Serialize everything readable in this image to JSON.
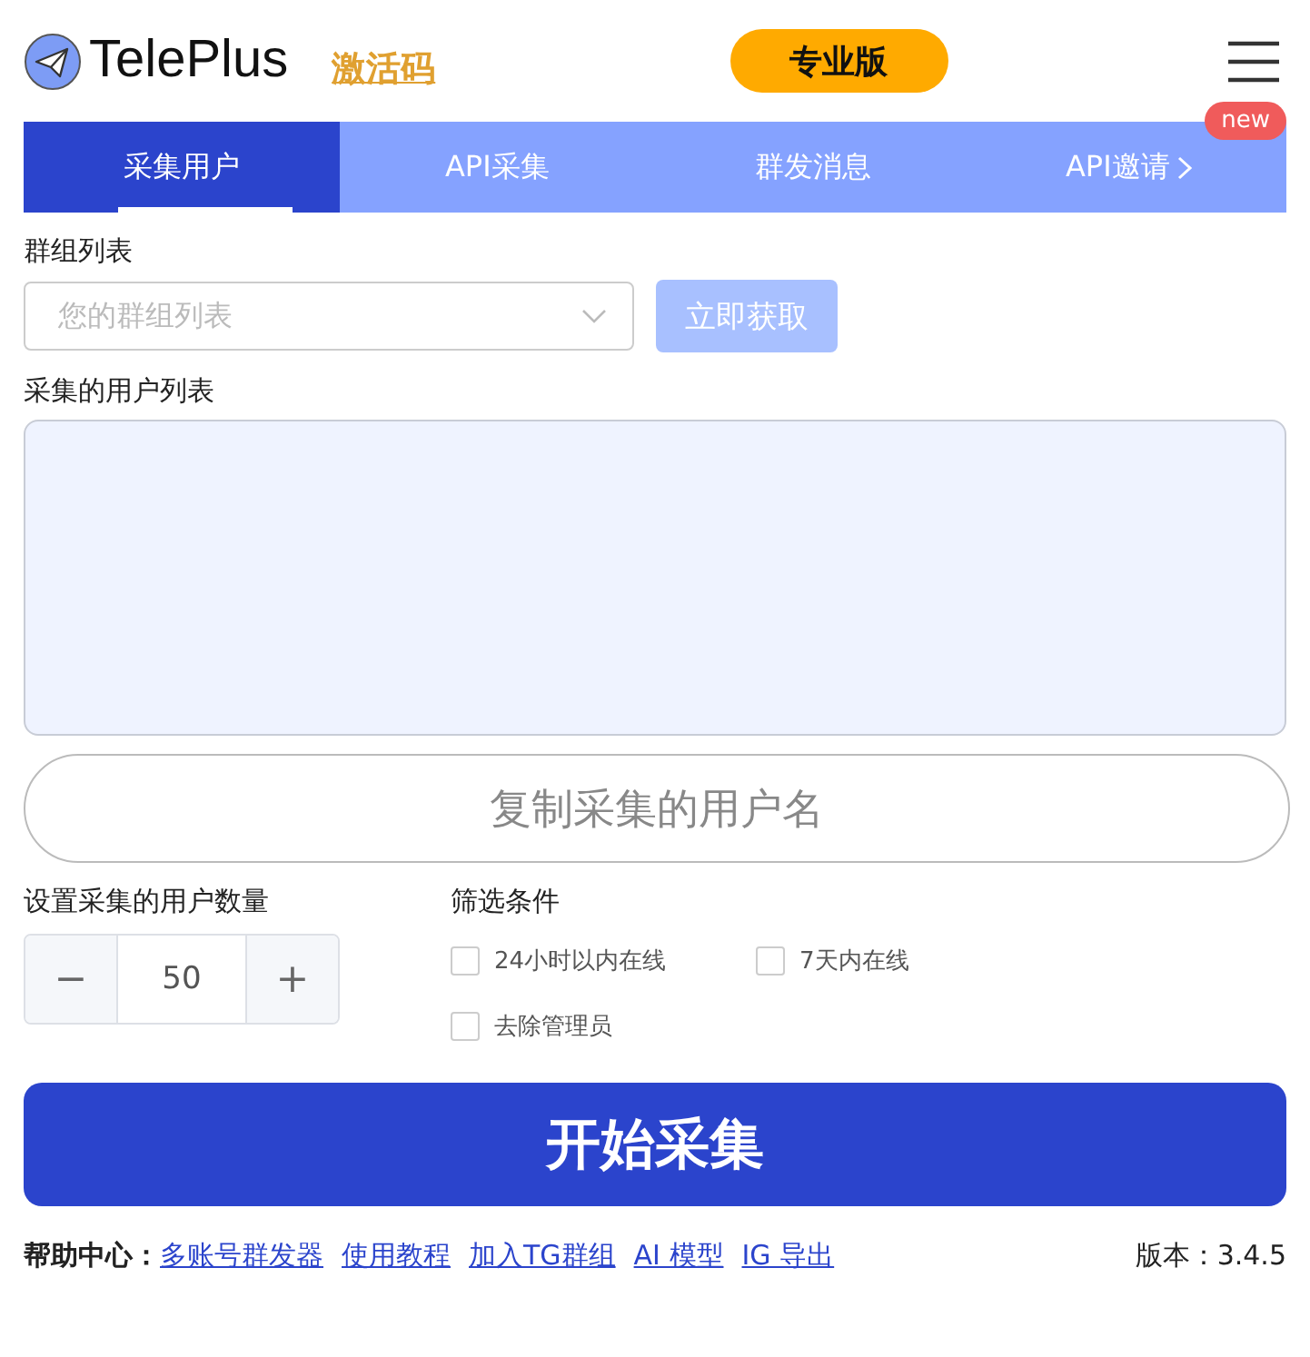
{
  "header": {
    "brand": "TelePlus",
    "activation_link": "激活码",
    "pro_button": "专业版"
  },
  "tabs": [
    {
      "label": "采集用户",
      "selected": true,
      "chevron": false
    },
    {
      "label": "API采集",
      "selected": false,
      "chevron": false
    },
    {
      "label": "群发消息",
      "selected": false,
      "chevron": false
    },
    {
      "label": "API邀请",
      "selected": false,
      "badge": "new",
      "chevron": true
    }
  ],
  "group_list": {
    "label": "群组列表",
    "placeholder": "您的群组列表",
    "fetch_button": "立即获取",
    "fetch_disabled": true
  },
  "user_list": {
    "label": "采集的用户列表",
    "copy_button": "复制采集的用户名"
  },
  "count": {
    "label": "设置采集的用户数量",
    "decrement": "−",
    "value": "50",
    "increment": "+"
  },
  "filters": {
    "label": "筛选条件",
    "options": [
      {
        "label": "24小时以内在线",
        "checked": false
      },
      {
        "label": "7天内在线",
        "checked": false
      },
      {
        "label": "去除管理员",
        "checked": false
      }
    ]
  },
  "start_button": "开始采集",
  "footer": {
    "help_label": "帮助中心：",
    "links": [
      "多账号群发器",
      "使用教程",
      "加入TG群组",
      "AI 模型",
      "IG 导出"
    ],
    "version": "版本：3.4.5"
  }
}
